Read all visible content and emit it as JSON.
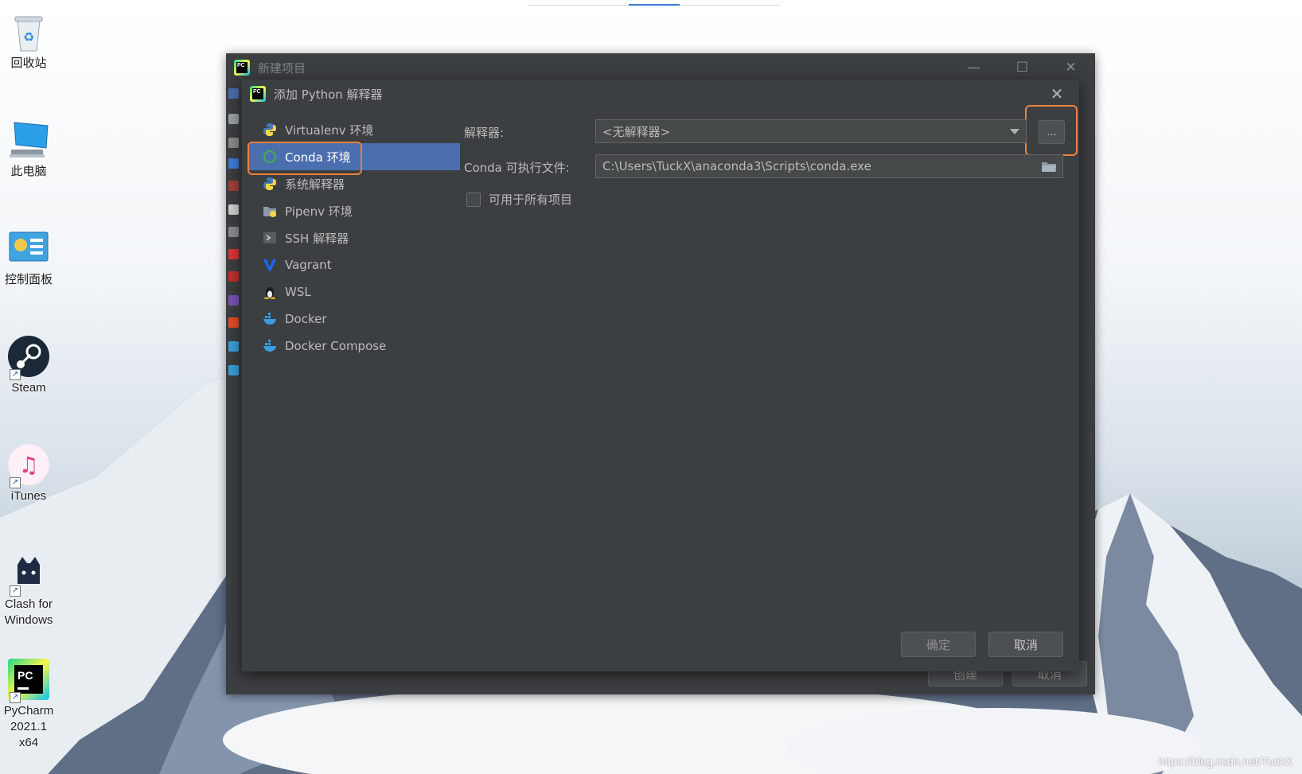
{
  "desktop": {
    "icons": [
      {
        "label": "回收站",
        "icon": "recycle-bin-icon"
      },
      {
        "label": "此电脑",
        "icon": "computer-icon"
      },
      {
        "label": "控制面板",
        "icon": "control-panel-icon"
      },
      {
        "label": "Steam",
        "icon": "steam-icon"
      },
      {
        "label": "iTunes",
        "icon": "itunes-icon"
      },
      {
        "label": "Clash for Windows",
        "icon": "clash-icon"
      },
      {
        "label": "PyCharm 2021.1 x64",
        "icon": "pycharm-icon"
      }
    ],
    "watermark": "https://blog.csdn.net/TuckX"
  },
  "outer_window": {
    "title": "新建项目",
    "minimize": "—",
    "maximize": "☐",
    "close": "✕",
    "create_label": "创建",
    "cancel_label": "取消"
  },
  "dialog": {
    "title": "添加 Python 解释器",
    "close": "✕",
    "menu": [
      {
        "label": "Virtualenv 环境",
        "icon": "python-icon"
      },
      {
        "label": "Conda 环境",
        "icon": "conda-icon",
        "selected": true
      },
      {
        "label": "系统解释器",
        "icon": "python-icon"
      },
      {
        "label": "Pipenv 环境",
        "icon": "pipenv-icon"
      },
      {
        "label": "SSH 解释器",
        "icon": "terminal-icon"
      },
      {
        "label": "Vagrant",
        "icon": "vagrant-icon"
      },
      {
        "label": "WSL",
        "icon": "linux-icon"
      },
      {
        "label": "Docker",
        "icon": "docker-icon"
      },
      {
        "label": "Docker Compose",
        "icon": "docker-icon"
      }
    ],
    "interpreter_label": "解释器:",
    "interpreter_value": "<无解释器>",
    "dots_label": "...",
    "conda_exe_label": "Conda 可执行文件:",
    "conda_exe_value": "C:\\Users\\TuckX\\anaconda3\\Scripts\\conda.exe",
    "make_available_label": "可用于所有项目",
    "make_available_checked": false,
    "ok_label": "确定",
    "cancel_label": "取消"
  },
  "colors": {
    "dialog_bg": "#3c3f41",
    "selection": "#4b6eaf",
    "highlight_outline": "#f0803c"
  }
}
